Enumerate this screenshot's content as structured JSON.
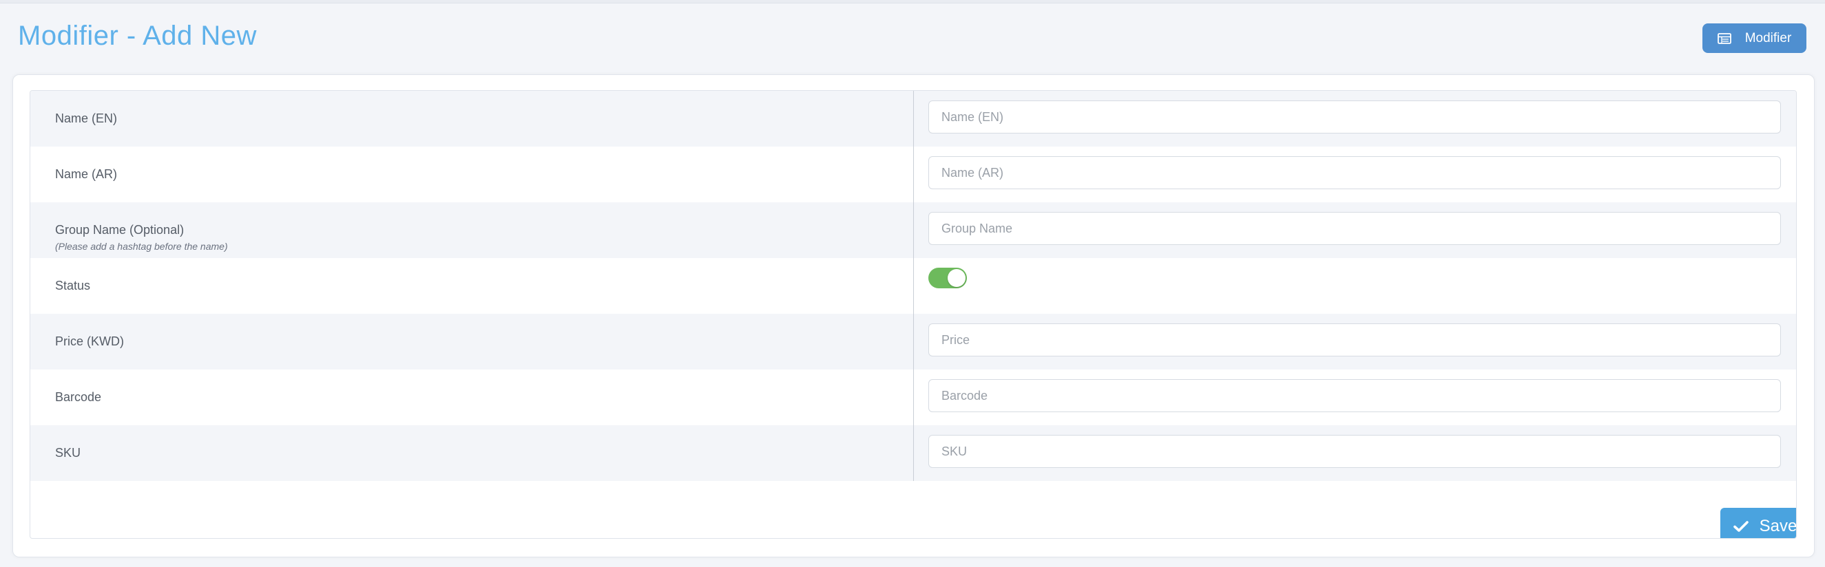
{
  "header": {
    "title": "Modifier - Add New",
    "modifier_button_label": "Modifier",
    "modifier_button_icon": "table-list-icon"
  },
  "form": {
    "rows": [
      {
        "label": "Name (EN)",
        "placeholder": "Name (EN)"
      },
      {
        "label": "Name (AR)",
        "placeholder": "Name (AR)"
      },
      {
        "label": "Group Name (Optional)",
        "sublabel": "(Please add a hashtag before the name)",
        "placeholder": "Group Name"
      },
      {
        "label": "Status",
        "toggle_on": true
      },
      {
        "label": "Price (KWD)",
        "placeholder": "Price"
      },
      {
        "label": "Barcode",
        "placeholder": "Barcode"
      },
      {
        "label": "SKU",
        "placeholder": "SKU"
      }
    ],
    "save_label": "Save",
    "save_icon": "checkmark-icon"
  },
  "colors": {
    "title": "#5fb1ea",
    "primary_button": "#4f8fd0",
    "save_button": "#4aa3df",
    "toggle_on": "#6dba5c"
  }
}
